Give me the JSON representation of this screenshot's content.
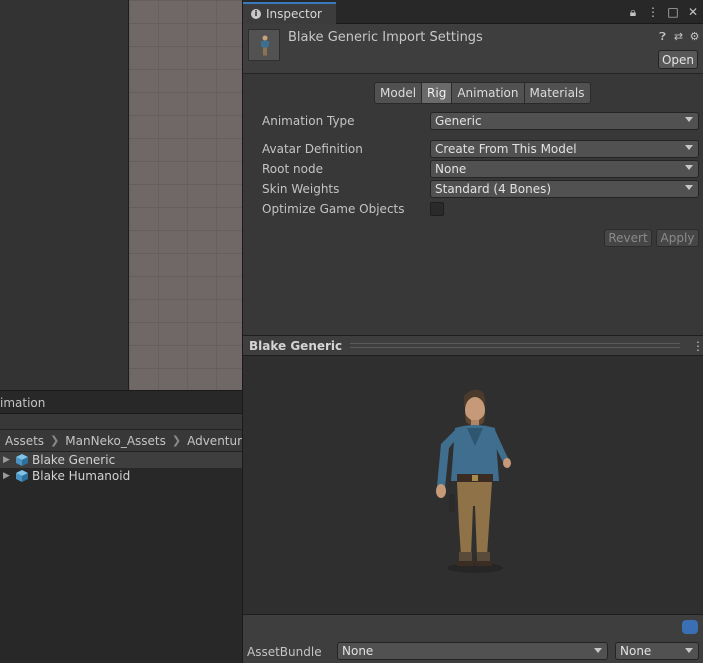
{
  "project": {
    "tab_title": "imation",
    "breadcrumb": [
      "Assets",
      "ManNeko_Assets",
      "Adventurer I"
    ],
    "items": [
      {
        "label": "Blake Generic",
        "icon": "prefab-cube-icon"
      },
      {
        "label": "Blake Humanoid",
        "icon": "prefab-cube-icon"
      }
    ]
  },
  "inspector": {
    "tab_label": "Inspector",
    "window_icons": [
      "lock-icon",
      "kebab-menu-icon",
      "maximize-icon",
      "close-icon"
    ],
    "title": "Blake Generic Import Settings",
    "header_icons": [
      "help-icon",
      "preset-icon",
      "settings-icon"
    ],
    "open_label": "Open",
    "tabs": [
      {
        "label": "Model",
        "active": false
      },
      {
        "label": "Rig",
        "active": true
      },
      {
        "label": "Animation",
        "active": false
      },
      {
        "label": "Materials",
        "active": false
      }
    ],
    "fields": {
      "animation_type": {
        "label": "Animation Type",
        "value": "Generic"
      },
      "avatar_definition": {
        "label": "Avatar Definition",
        "value": "Create From This Model"
      },
      "root_node": {
        "label": "Root node",
        "value": "None"
      },
      "skin_weights": {
        "label": "Skin Weights",
        "value": "Standard (4 Bones)"
      },
      "optimize": {
        "label": "Optimize Game Objects",
        "checked": false
      }
    },
    "revert_label": "Revert",
    "apply_label": "Apply",
    "preview_title": "Blake Generic",
    "assetbundle": {
      "label": "AssetBundle",
      "name_value": "None",
      "variant_value": "None"
    }
  },
  "colors": {
    "accent": "#3a79bb",
    "panel": "#383838",
    "dark": "#282828",
    "tag": "#3a6fb4"
  }
}
